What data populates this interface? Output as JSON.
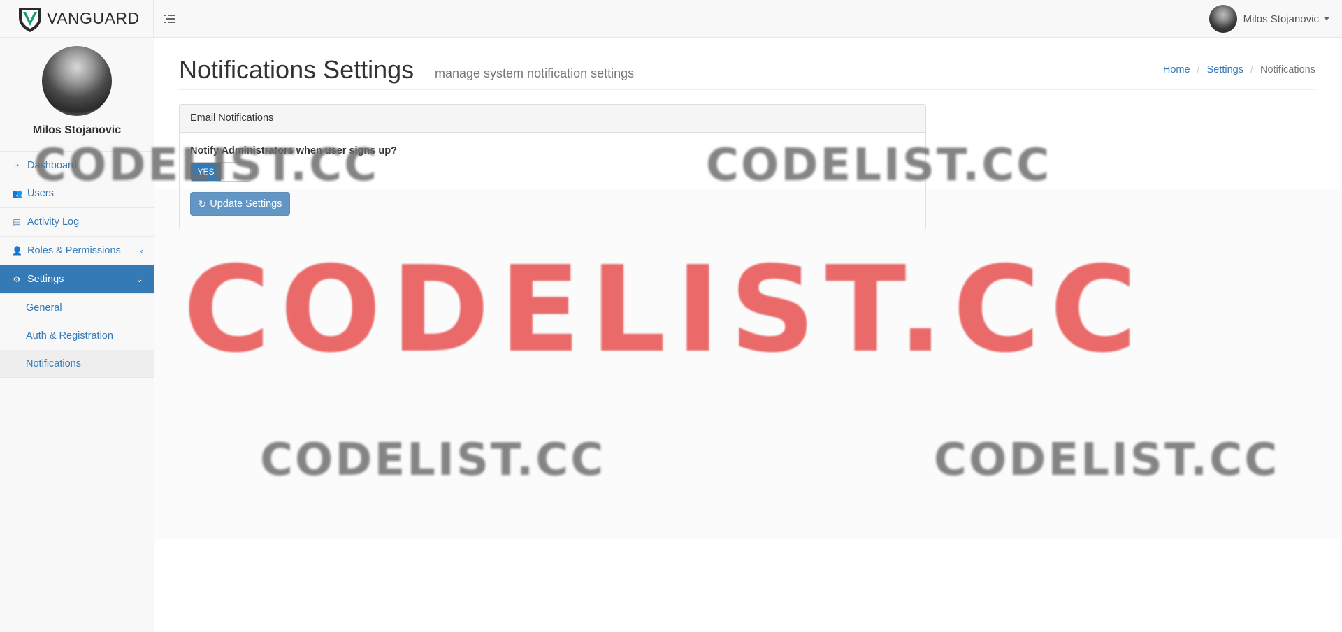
{
  "brand": {
    "name_light": "VAN",
    "name_bold": "GUARD",
    "accent": "#1a9b74"
  },
  "topbar": {
    "user_name": "Milos Stojanovic"
  },
  "sidebar": {
    "profile_name": "Milos Stojanovic",
    "items": [
      {
        "label": "Dashboard",
        "icon": "dashboard-icon"
      },
      {
        "label": "Users",
        "icon": "users-icon"
      },
      {
        "label": "Activity Log",
        "icon": "list-icon"
      },
      {
        "label": "Roles & Permissions",
        "icon": "user-icon"
      },
      {
        "label": "Settings",
        "icon": "gear-icon"
      }
    ],
    "sub_items": [
      {
        "label": "General"
      },
      {
        "label": "Auth & Registration"
      },
      {
        "label": "Notifications"
      }
    ]
  },
  "page": {
    "title": "Notifications Settings",
    "subtitle": "manage system notification settings",
    "breadcrumb": {
      "home": "Home",
      "settings": "Settings",
      "current": "Notifications",
      "separator": "/"
    }
  },
  "panel": {
    "heading": "Email Notifications",
    "question": "Notify Administrators when user signs up?",
    "switch_label": "YES",
    "button_label": "Update Settings"
  },
  "watermark": {
    "text": "CODELIST.CC"
  },
  "colors": {
    "primary": "#337ab7",
    "watermark_red": "#e65050"
  }
}
